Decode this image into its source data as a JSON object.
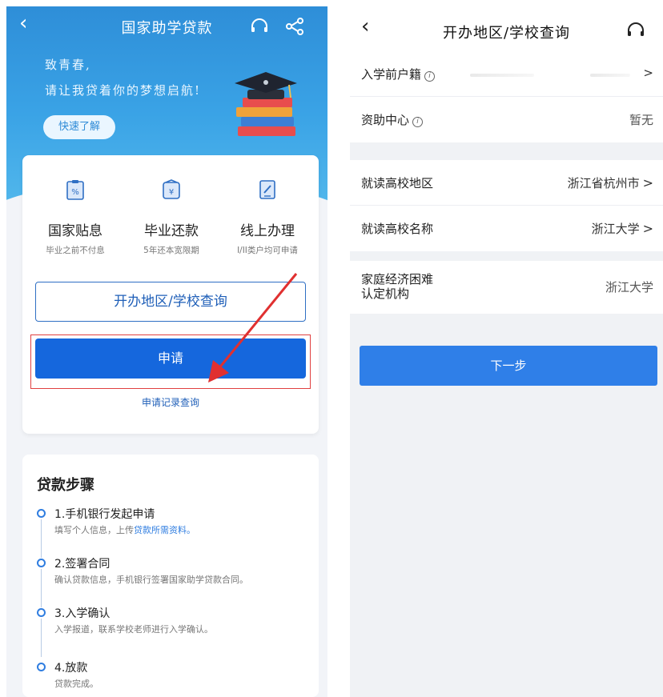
{
  "left": {
    "nav": {
      "title": "国家助学贷款",
      "back_icon": "back-chevron-icon",
      "headset_icon": "headset-icon",
      "share_icon": "share-icon"
    },
    "banner": {
      "slogan_line1": "致青春,",
      "slogan_line2": "请让我贷着你的梦想启航!",
      "quick_button": "快速了解"
    },
    "features": [
      {
        "icon": "percent-clipboard-icon",
        "title": "国家贴息",
        "subtitle": "毕业之前不付息"
      },
      {
        "icon": "yen-wallet-icon",
        "title": "毕业还款",
        "subtitle": "5年还本宽限期"
      },
      {
        "icon": "tablet-pen-icon",
        "title": "线上办理",
        "subtitle": "I/II类户均可申请"
      }
    ],
    "query_button": "开办地区/学校查询",
    "apply_button": "申请",
    "record_link": "申请记录查询",
    "steps": {
      "title": "贷款步骤",
      "items": [
        {
          "title": "1.手机银行发起申请",
          "desc": "填写个人信息，上传",
          "desc_link": "贷款所需资料。"
        },
        {
          "title": "2.签署合同",
          "desc": "确认贷款信息，手机银行签署国家助学贷款合同。",
          "desc_link": ""
        },
        {
          "title": "3.入学确认",
          "desc": "入学报道，联系学校老师进行入学确认。",
          "desc_link": ""
        },
        {
          "title": "4.放款",
          "desc": "贷款完成。",
          "desc_link": ""
        }
      ]
    },
    "colors": {
      "banner_top": "#2e8ed8",
      "primary_button": "#1567dd",
      "highlight_border": "#e04040",
      "arrow": "#e03030"
    }
  },
  "right": {
    "nav": {
      "title": "开办地区/学校查询",
      "back_icon": "back-chevron-icon",
      "headset_icon": "headset-icon"
    },
    "rows": {
      "household": {
        "label": "入学前户籍",
        "value": "",
        "chevron": ">"
      },
      "aid_center": {
        "label": "资助中心",
        "value": "暂无"
      },
      "school_region": {
        "label": "就读高校地区",
        "value": "浙江省杭州市",
        "chevron": ">"
      },
      "school_name": {
        "label": "就读高校名称",
        "value": "浙江大学",
        "chevron": ">"
      },
      "org": {
        "label_line1": "家庭经济困难",
        "label_line2": "认定机构",
        "value": "浙江大学"
      }
    },
    "next_button": "下一步",
    "colors": {
      "next_button": "#2f7fe8"
    }
  }
}
